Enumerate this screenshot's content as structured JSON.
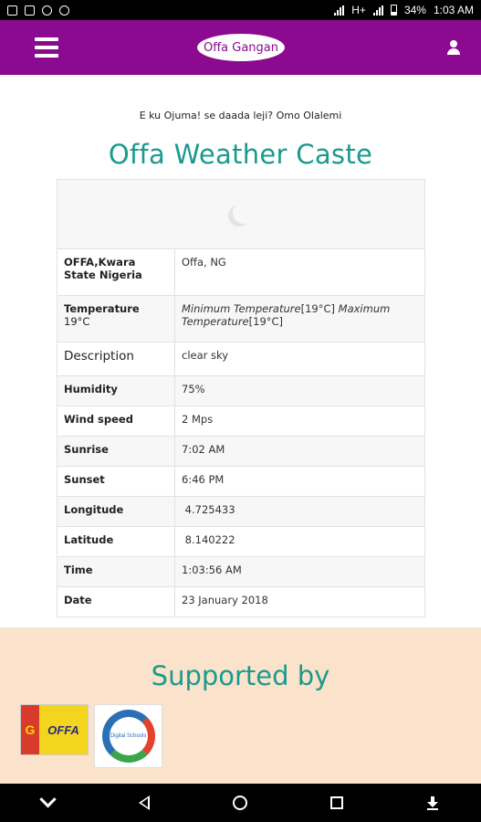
{
  "status_bar": {
    "battery": "34%",
    "time": "1:03 AM",
    "network": "H+"
  },
  "app_bar": {
    "logo_text": "Offa Gangan",
    "menu_icon": "hamburger-menu-icon",
    "account_icon": "user-icon"
  },
  "main": {
    "greeting": "E ku Ojuma! se daada leji? Omo Olalemi",
    "title": "Offa Weather Caste",
    "weather_icon": "night-moon-icon",
    "location": {
      "label": "OFFA,Kwara State Nigeria",
      "value": "Offa, NG"
    },
    "temperature": {
      "label": "Temperature",
      "temp": "19°C",
      "min_label": "Minimum Temperature",
      "min": "[19°C]",
      "max_label": "Maximum Temperature",
      "max": "[19°C]"
    },
    "rows": [
      {
        "label": "Description",
        "value": "clear sky"
      },
      {
        "label": "Humidity",
        "value": "75%"
      },
      {
        "label": "Wind speed",
        "value": "2 Mps"
      },
      {
        "label": "Sunrise",
        "value": "7:02 AM"
      },
      {
        "label": "Sunset",
        "value": "6:46 PM"
      },
      {
        "label": "Longitude",
        "value": " 4.725433"
      },
      {
        "label": "Latitude",
        "value": " 8.140222"
      },
      {
        "label": "Time",
        "value": "1:03:56 AM"
      },
      {
        "label": "Date",
        "value": "23 January 2018"
      }
    ]
  },
  "support": {
    "title": "Supported by",
    "sponsor1_text": "OFFA",
    "sponsor2_text": "Digital Schools"
  },
  "colors": {
    "brand_purple": "#8b0a8f",
    "title_teal": "#1a9a8e",
    "support_bg": "#fbe3cb"
  }
}
